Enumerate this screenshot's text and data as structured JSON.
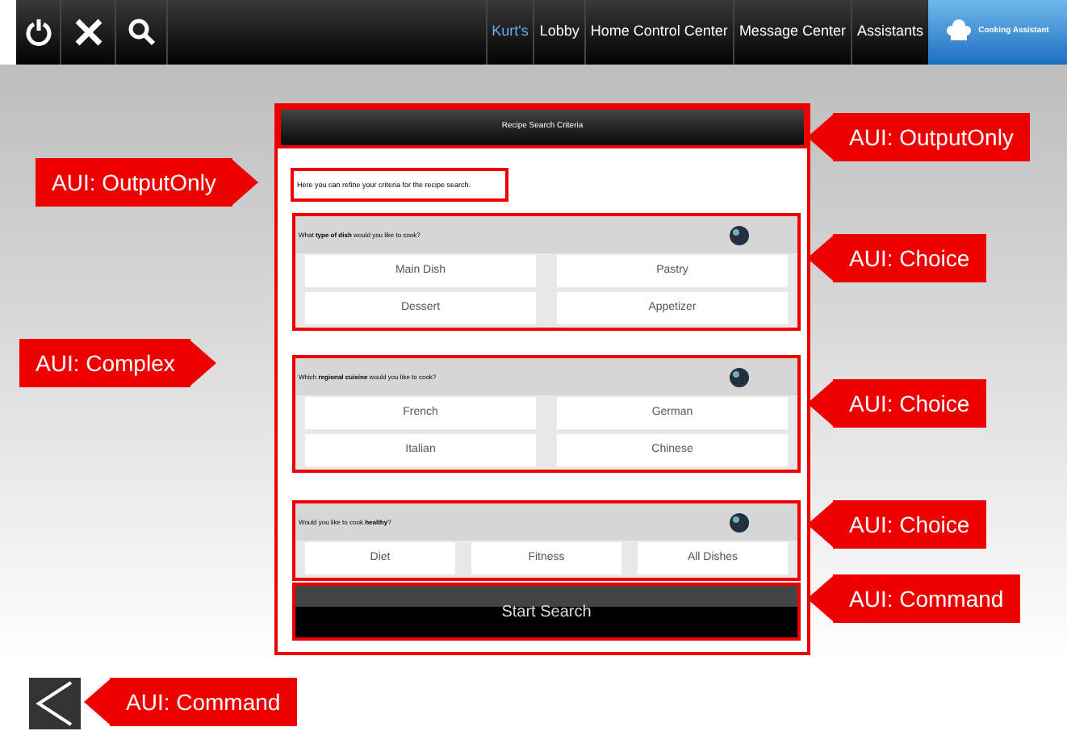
{
  "toolbar": {
    "nav": [
      {
        "label": "Kurt's",
        "selected": true
      },
      {
        "label": "Lobby",
        "selected": false
      },
      {
        "label": "Home Control Center",
        "selected": false
      },
      {
        "label": "Message Center",
        "selected": false
      },
      {
        "label": "Assistants",
        "selected": false
      }
    ],
    "logo_text": "Cooking Assistant"
  },
  "panel": {
    "title": "Recipe Search Criteria",
    "intro": "Here you can refine your criteria for the recipe search.",
    "groups": [
      {
        "question": "What **type of dish** would you like to cook?",
        "options": [
          "Main Dish",
          "Pastry",
          "Dessert",
          "Appetizer"
        ]
      },
      {
        "question": "Which **regional cuisine** would you like to cook?",
        "options": [
          "French",
          "German",
          "Italian",
          "Chinese"
        ]
      },
      {
        "question": "Would you like to cook **healthy**?",
        "options": [
          "Diet",
          "Fitness",
          "All Dishes"
        ]
      }
    ],
    "command": "Start Search"
  },
  "annotations": [
    {
      "text": "AUI: OutputOnly"
    },
    {
      "text": "AUI: OutputOnly"
    },
    {
      "text": "AUI: Choice"
    },
    {
      "text": "AUI: Complex"
    },
    {
      "text": "AUI: Choice"
    },
    {
      "text": "AUI: Choice"
    },
    {
      "text": "AUI: Command"
    },
    {
      "text": "AUI: Command"
    }
  ]
}
